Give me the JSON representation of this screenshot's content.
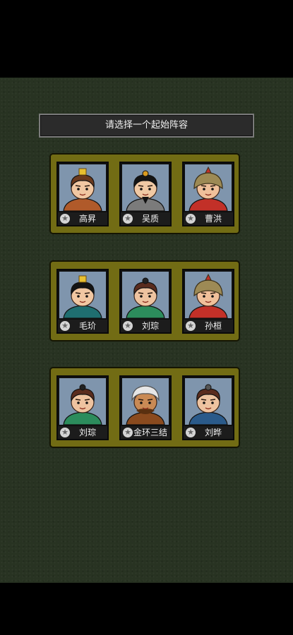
{
  "title": "请选择一个起始阵容",
  "groups": [
    {
      "heroes": [
        {
          "name": "高昇",
          "icon": "hero-portrait-crowned-boy",
          "hair": "#6b3a1e",
          "skin": "#f1c7a2",
          "hat": "#e8c030",
          "robe": "#b05a2a"
        },
        {
          "name": "吴质",
          "icon": "hero-portrait-bearded-scholar",
          "hair": "#141414",
          "skin": "#f0c9a4",
          "hat": "#d89a20",
          "robe": "#7b7b7b"
        },
        {
          "name": "曹洪",
          "icon": "hero-portrait-helmet-general",
          "hair": "#8e7a48",
          "skin": "#f0c09a",
          "hat": "#9d8a55",
          "robe": "#c23028"
        }
      ]
    },
    {
      "heroes": [
        {
          "name": "毛玠",
          "icon": "hero-portrait-crowned-official",
          "hair": "#141414",
          "skin": "#f1c7a2",
          "hat": "#e8c030",
          "robe": "#1f6e70"
        },
        {
          "name": "刘琮",
          "icon": "hero-portrait-young-noble",
          "hair": "#5a2c1e",
          "skin": "#eec3a0",
          "hat": "#222222",
          "robe": "#2c8c5c"
        },
        {
          "name": "孙桓",
          "icon": "hero-portrait-helmet-warrior",
          "hair": "#8e7a48",
          "skin": "#f0c09a",
          "hat": "#9d8a55",
          "robe": "#c23028"
        }
      ]
    },
    {
      "heroes": [
        {
          "name": "刘琮",
          "icon": "hero-portrait-young-noble",
          "hair": "#5a2c1e",
          "skin": "#eec3a0",
          "hat": "#222222",
          "robe": "#2c8c5c"
        },
        {
          "name": "金环三结",
          "icon": "hero-portrait-nanman-chief",
          "hair": "#e6e6e6",
          "skin": "#c98a55",
          "hat": "#f2f2f2",
          "robe": "#8a4a1e"
        },
        {
          "name": "刘晔",
          "icon": "hero-portrait-topknot-strategist",
          "hair": "#5a2c1e",
          "skin": "#eec3a0",
          "hat": "#555555",
          "robe": "#2a5a8a"
        }
      ]
    }
  ],
  "colors": {
    "background": "#283322",
    "panel": "#726c14",
    "portrait_bg": "#7f95ad"
  }
}
